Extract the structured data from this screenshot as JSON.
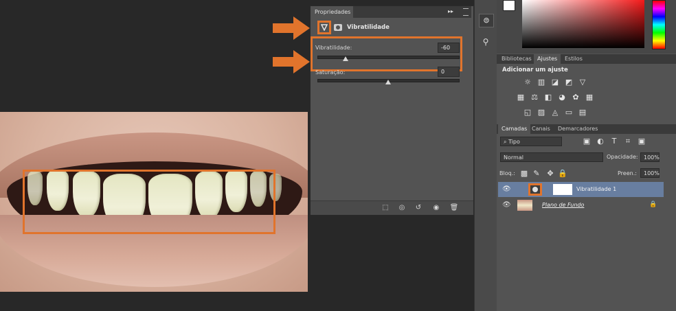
{
  "properties_panel": {
    "tab_label": "Propriedades",
    "expand_glyph": "▸▸",
    "title": "Vibratilidade",
    "vibrance": {
      "label": "Vibratilidade:",
      "value": "-60",
      "level": -60
    },
    "saturation": {
      "label": "Saturação:",
      "value": "0",
      "level": 0
    },
    "toolbar_icons": [
      "clip-to-layer-icon",
      "view-previous-icon",
      "reset-icon",
      "visibility-icon",
      "delete-icon"
    ]
  },
  "right_panels": {
    "adjust_tabs": [
      "Bibliotecas",
      "Ajustes",
      "Estilos"
    ],
    "adjust_active": "Ajustes",
    "adjust_heading": "Adicionar um ajuste",
    "layer_tabs": [
      "Camadas",
      "Canais",
      "Demarcadores"
    ],
    "layer_active": "Camadas",
    "filter_kind": "Tipo",
    "blend_mode": "Normal",
    "opacity_label": "Opacidade:",
    "opacity_value": "100%",
    "lock_label": "Bloq.:",
    "fill_label": "Preen.:",
    "fill_value": "100%",
    "layers": [
      {
        "name": "Vibratilidade 1",
        "selected": true
      },
      {
        "name": "Plano de Fundo",
        "selected": false
      }
    ]
  },
  "colors": {
    "accent_orange": "#e1742c",
    "panel_bg": "#535353",
    "selection": "#687ea0"
  }
}
